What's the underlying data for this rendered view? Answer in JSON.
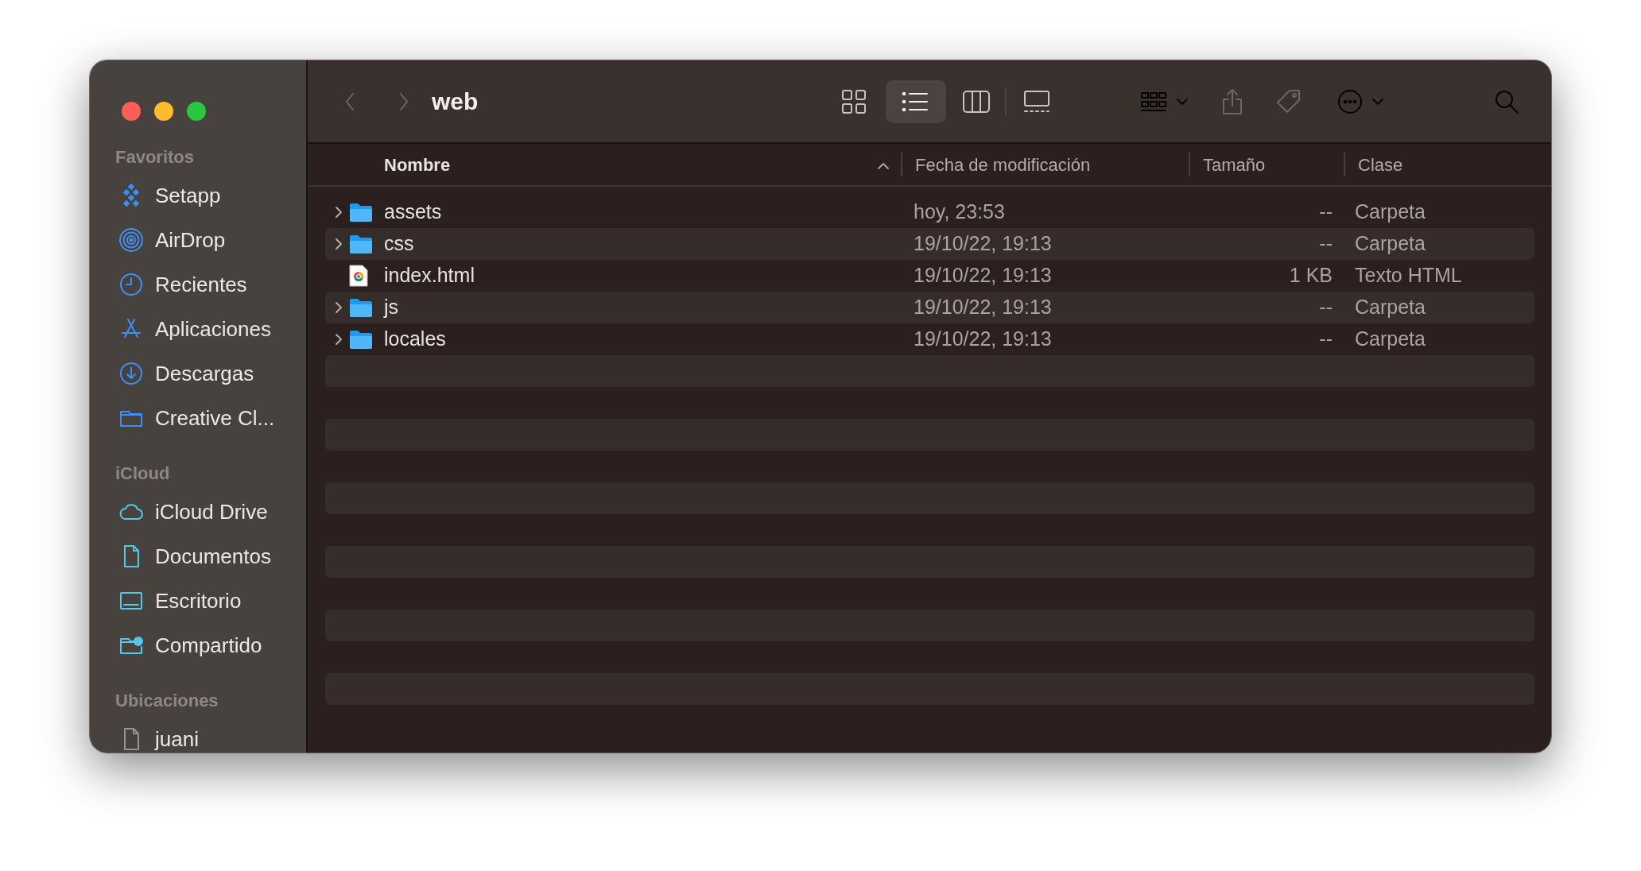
{
  "window": {
    "title": "web"
  },
  "sidebar": {
    "sections": [
      {
        "title": "Favoritos",
        "items": [
          {
            "label": "Setapp",
            "kind": "setapp"
          },
          {
            "label": "AirDrop",
            "kind": "airdrop"
          },
          {
            "label": "Recientes",
            "kind": "clock"
          },
          {
            "label": "Aplicaciones",
            "kind": "apps"
          },
          {
            "label": "Descargas",
            "kind": "download"
          },
          {
            "label": "Creative Cl...",
            "kind": "folder"
          }
        ]
      },
      {
        "title": "iCloud",
        "items": [
          {
            "label": "iCloud Drive",
            "kind": "cloud"
          },
          {
            "label": "Documentos",
            "kind": "doc"
          },
          {
            "label": "Escritorio",
            "kind": "desktop"
          },
          {
            "label": "Compartido",
            "kind": "shared"
          }
        ]
      },
      {
        "title": "Ubicaciones",
        "items": [
          {
            "label": "juani",
            "kind": "disk"
          }
        ]
      }
    ]
  },
  "view_buttons": [
    {
      "kind": "icons",
      "selected": false
    },
    {
      "kind": "list",
      "selected": true
    },
    {
      "kind": "columns",
      "selected": false
    },
    {
      "kind": "gallery",
      "selected": false
    }
  ],
  "table": {
    "columns": [
      {
        "label": "Nombre",
        "sorted": true
      },
      {
        "label": "Fecha de modificación",
        "sorted": false
      },
      {
        "label": "Tamaño",
        "sorted": false
      },
      {
        "label": "Clase",
        "sorted": false
      }
    ],
    "rows": [
      {
        "kind": "folder",
        "name": "assets",
        "date": "hoy, 23:53",
        "size": "--",
        "type": "Carpeta"
      },
      {
        "kind": "folder",
        "name": "css",
        "date": "19/10/22, 19:13",
        "size": "--",
        "type": "Carpeta"
      },
      {
        "kind": "html",
        "name": "index.html",
        "date": "19/10/22, 19:13",
        "size": "1 KB",
        "type": "Texto HTML"
      },
      {
        "kind": "folder",
        "name": "js",
        "date": "19/10/22, 19:13",
        "size": "--",
        "type": "Carpeta"
      },
      {
        "kind": "folder",
        "name": "locales",
        "date": "19/10/22, 19:13",
        "size": "--",
        "type": "Carpeta"
      }
    ]
  }
}
